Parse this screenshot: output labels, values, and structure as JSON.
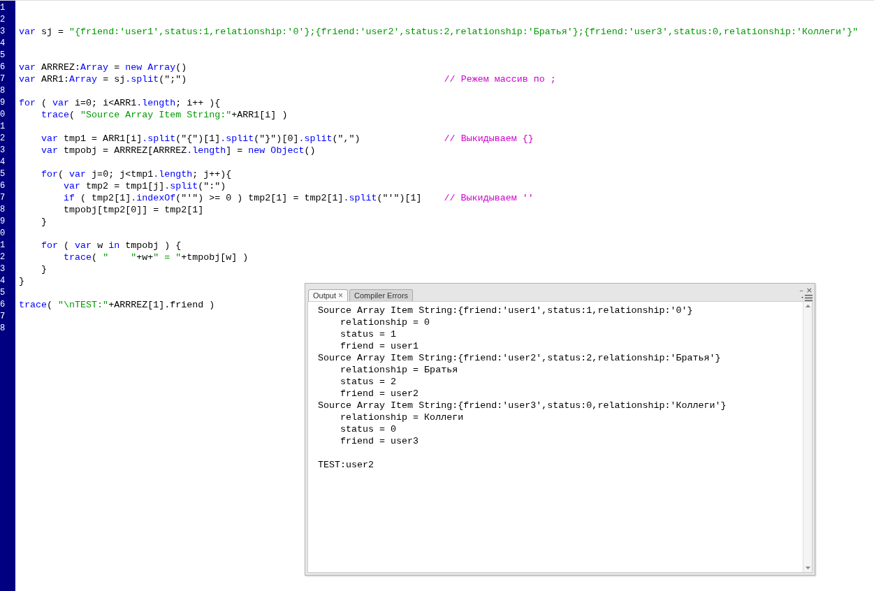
{
  "editor": {
    "rows": [
      {
        "number": "1"
      },
      {
        "number": "2"
      },
      {
        "number": "3",
        "tokens": [
          {
            "kind": "keyword",
            "text": "var"
          },
          {
            "kind": "plain",
            "text": " sj = "
          },
          {
            "kind": "string",
            "text": "\"{friend:'user1',status:1,relationship:'0'};{friend:'user2',status:2,relationship:'Братья'};{friend:'user3',status:0,relationship:'Коллеги'}\""
          }
        ]
      },
      {
        "number": "4"
      },
      {
        "number": "5"
      },
      {
        "number": "6",
        "tokens": [
          {
            "kind": "keyword",
            "text": "var"
          },
          {
            "kind": "plain",
            "text": " ARRREZ:"
          },
          {
            "kind": "keyword",
            "text": "Array"
          },
          {
            "kind": "plain",
            "text": " = "
          },
          {
            "kind": "keyword",
            "text": "new Array"
          },
          {
            "kind": "plain",
            "text": "()"
          }
        ]
      },
      {
        "number": "7",
        "tokens": [
          {
            "kind": "keyword",
            "text": "var"
          },
          {
            "kind": "plain",
            "text": " ARR1:"
          },
          {
            "kind": "keyword",
            "text": "Array"
          },
          {
            "kind": "plain",
            "text": " = sj"
          },
          {
            "kind": "keyword",
            "text": ".split"
          },
          {
            "kind": "plain",
            "text": "(\";\")"
          },
          {
            "kind": "comment",
            "text": "// Режем массив по ;"
          }
        ]
      },
      {
        "number": "8"
      },
      {
        "number": "9",
        "tokens": [
          {
            "kind": "keyword",
            "text": "for"
          },
          {
            "kind": "plain",
            "text": " ( "
          },
          {
            "kind": "keyword",
            "text": "var"
          },
          {
            "kind": "plain",
            "text": " i=0; i<ARR1"
          },
          {
            "kind": "keyword",
            "text": ".length"
          },
          {
            "kind": "plain",
            "text": "; i++ ){"
          }
        ]
      },
      {
        "number": "0",
        "tokens": [
          {
            "kind": "keyword",
            "text": "    trace"
          },
          {
            "kind": "plain",
            "text": "( "
          },
          {
            "kind": "string",
            "text": "\"Source Array Item String:\""
          },
          {
            "kind": "plain",
            "text": "+ARR1[i] )"
          }
        ]
      },
      {
        "number": "1"
      },
      {
        "number": "2",
        "tokens": [
          {
            "kind": "keyword",
            "text": "    var"
          },
          {
            "kind": "plain",
            "text": " tmp1 = ARR1[i]"
          },
          {
            "kind": "keyword",
            "text": ".split"
          },
          {
            "kind": "plain",
            "text": "(\"{\")[1]"
          },
          {
            "kind": "keyword",
            "text": ".split"
          },
          {
            "kind": "plain",
            "text": "(\"}\")[0]"
          },
          {
            "kind": "keyword",
            "text": ".split"
          },
          {
            "kind": "plain",
            "text": "(\",\")"
          },
          {
            "kind": "comment",
            "text": "// Выкидываем {}"
          }
        ]
      },
      {
        "number": "3",
        "tokens": [
          {
            "kind": "keyword",
            "text": "    var"
          },
          {
            "kind": "plain",
            "text": " tmpobj = ARRREZ[ARRREZ"
          },
          {
            "kind": "keyword",
            "text": ".length"
          },
          {
            "kind": "plain",
            "text": "] = "
          },
          {
            "kind": "keyword",
            "text": "new Object"
          },
          {
            "kind": "plain",
            "text": "()"
          }
        ]
      },
      {
        "number": "4"
      },
      {
        "number": "5",
        "tokens": [
          {
            "kind": "keyword",
            "text": "    for"
          },
          {
            "kind": "plain",
            "text": "( "
          },
          {
            "kind": "keyword",
            "text": "var"
          },
          {
            "kind": "plain",
            "text": " j=0; j<tmp1"
          },
          {
            "kind": "keyword",
            "text": ".length"
          },
          {
            "kind": "plain",
            "text": "; j++){"
          }
        ]
      },
      {
        "number": "6",
        "tokens": [
          {
            "kind": "keyword",
            "text": "        var"
          },
          {
            "kind": "plain",
            "text": " tmp2 = tmp1[j]"
          },
          {
            "kind": "keyword",
            "text": ".split"
          },
          {
            "kind": "plain",
            "text": "(\":\")"
          }
        ]
      },
      {
        "number": "7",
        "tokens": [
          {
            "kind": "keyword",
            "text": "        if"
          },
          {
            "kind": "plain",
            "text": " ( tmp2[1]"
          },
          {
            "kind": "keyword",
            "text": ".indexOf"
          },
          {
            "kind": "plain",
            "text": "(\"'\") >= 0 ) tmp2[1] = tmp2[1]"
          },
          {
            "kind": "keyword",
            "text": ".split"
          },
          {
            "kind": "plain",
            "text": "(\"'\")[1]"
          },
          {
            "kind": "comment",
            "text": "// Выкидываем ''"
          }
        ]
      },
      {
        "number": "8",
        "tokens": [
          {
            "kind": "plain",
            "text": "        tmpobj[tmp2[0]] = tmp2[1]"
          }
        ]
      },
      {
        "number": "9",
        "tokens": [
          {
            "kind": "plain",
            "text": "    }"
          }
        ]
      },
      {
        "number": "0"
      },
      {
        "number": "1",
        "tokens": [
          {
            "kind": "keyword",
            "text": "    for"
          },
          {
            "kind": "plain",
            "text": " ( "
          },
          {
            "kind": "keyword",
            "text": "var"
          },
          {
            "kind": "plain",
            "text": " w "
          },
          {
            "kind": "keyword",
            "text": "in"
          },
          {
            "kind": "plain",
            "text": " tmpobj ) {"
          }
        ]
      },
      {
        "number": "2",
        "tokens": [
          {
            "kind": "keyword",
            "text": "        trace"
          },
          {
            "kind": "plain",
            "text": "( "
          },
          {
            "kind": "string",
            "text": "\"    \""
          },
          {
            "kind": "plain",
            "text": "+w+"
          },
          {
            "kind": "string",
            "text": "\" = \""
          },
          {
            "kind": "plain",
            "text": "+tmpobj[w] )"
          }
        ]
      },
      {
        "number": "3",
        "tokens": [
          {
            "kind": "plain",
            "text": "    }"
          }
        ]
      },
      {
        "number": "4",
        "tokens": [
          {
            "kind": "plain",
            "text": "}"
          }
        ]
      },
      {
        "number": "5"
      },
      {
        "number": "6",
        "tokens": [
          {
            "kind": "keyword",
            "text": "trace"
          },
          {
            "kind": "plain",
            "text": "( "
          },
          {
            "kind": "string",
            "text": "\"\\nTEST:\""
          },
          {
            "kind": "plain",
            "text": "+ARRREZ[1].friend )"
          }
        ]
      },
      {
        "number": "7"
      },
      {
        "number": "8"
      }
    ]
  },
  "output_panel": {
    "tabs": [
      {
        "label": "Output",
        "close": "×",
        "selected": true
      },
      {
        "label": "Compiler Errors",
        "selected": false
      }
    ],
    "window_controls": [
      "–",
      "×"
    ],
    "entries": [
      {
        "text": "Source Array Item String:{friend:'user1',status:1,relationship:'0'}",
        "children": [
          {
            "text": "relationship = 0"
          },
          {
            "text": "status = 1"
          },
          {
            "text": "friend = user1"
          }
        ]
      },
      {
        "text": "Source Array Item String:{friend:'user2',status:2,relationship:'Братья'}",
        "children": [
          {
            "text": "relationship = Братья"
          },
          {
            "text": "status = 2"
          },
          {
            "text": "friend = user2"
          }
        ]
      },
      {
        "text": "Source Array Item String:{friend:'user3',status:0,relationship:'Коллеги'}",
        "children": [
          {
            "text": "relationship = Коллеги"
          },
          {
            "text": "status = 0"
          },
          {
            "text": "friend = user3"
          }
        ]
      },
      {
        "text": "TEST:user2",
        "blank_line_before": true
      }
    ]
  }
}
